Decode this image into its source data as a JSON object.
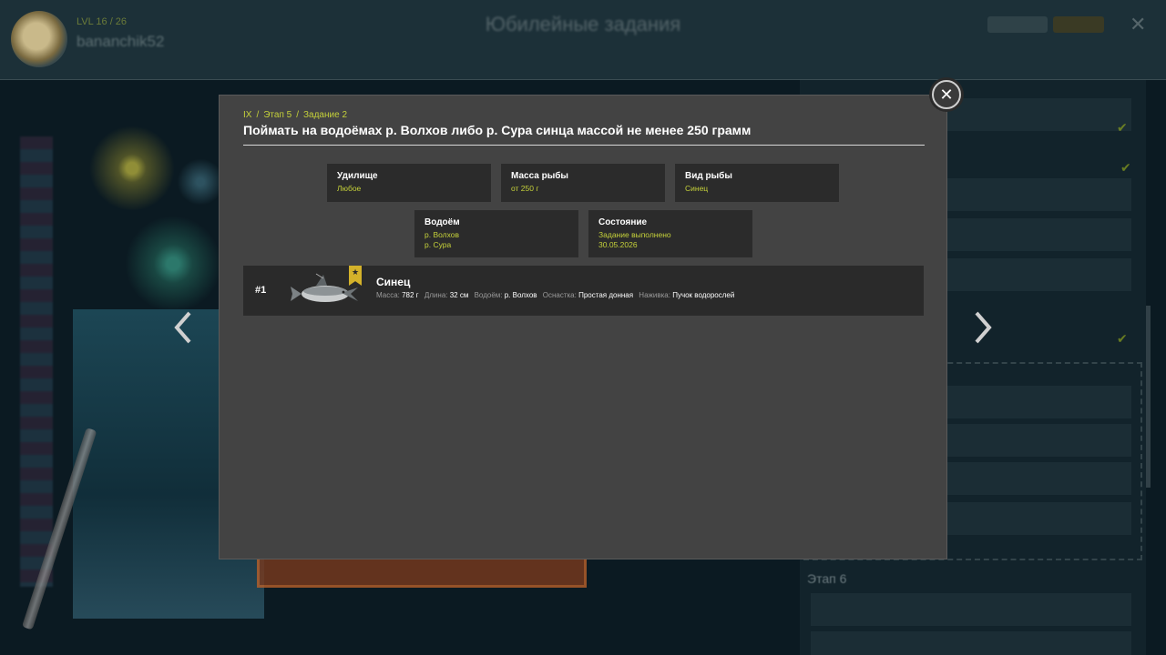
{
  "header": {
    "level": "LVL 16 / 26",
    "username": "bananchik52",
    "title": "Юбилейные задания",
    "close_icon": "close-icon"
  },
  "modal": {
    "breadcrumb": [
      "IX",
      "Этап 5",
      "Задание 2"
    ],
    "title": "Поймать на водоёмах р. Волхов либо р. Сура синца массой не менее 250 грамм",
    "conditions": {
      "rod": {
        "label": "Удилище",
        "value": "Любое"
      },
      "mass": {
        "label": "Масса рыбы",
        "value": "от 250 г"
      },
      "species": {
        "label": "Вид рыбы",
        "value": "Синец"
      },
      "water": {
        "label": "Водоём",
        "values": [
          "р. Волхов",
          "р. Сура"
        ]
      },
      "state": {
        "label": "Состояние",
        "values": [
          "Задание выполнено",
          "30.05.2026"
        ]
      }
    },
    "catch": {
      "rank": "#1",
      "name": "Синец",
      "mass_label": "Масса:",
      "mass": "782 г",
      "length_label": "Длина:",
      "length": "32 см",
      "water_label": "Водоём:",
      "water": "р. Волхов",
      "tackle_label": "Оснастка:",
      "tackle": "Простая донная",
      "bait_label": "Наживка:",
      "bait": "Пучок водорослей"
    }
  },
  "colors": {
    "accent": "#c5d13a",
    "modal_bg": "#434343",
    "card_bg": "#2b2b2b"
  }
}
